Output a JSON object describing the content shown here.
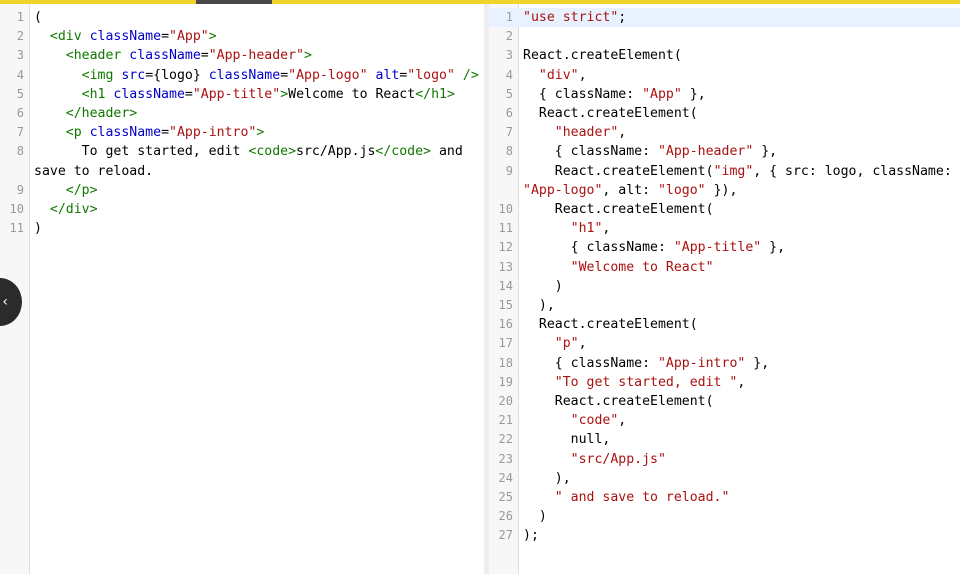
{
  "left_editor": {
    "lines": [
      {
        "num": "1",
        "tokens": [
          {
            "t": "(",
            "c": "def"
          }
        ]
      },
      {
        "num": "2",
        "tokens": [
          {
            "t": "  ",
            "c": "def"
          },
          {
            "t": "<div",
            "c": "tag"
          },
          {
            "t": " ",
            "c": "def"
          },
          {
            "t": "className",
            "c": "attr"
          },
          {
            "t": "=",
            "c": "def"
          },
          {
            "t": "\"App\"",
            "c": "str"
          },
          {
            "t": ">",
            "c": "tag"
          }
        ]
      },
      {
        "num": "3",
        "tokens": [
          {
            "t": "    ",
            "c": "def"
          },
          {
            "t": "<header",
            "c": "tag"
          },
          {
            "t": " ",
            "c": "def"
          },
          {
            "t": "className",
            "c": "attr"
          },
          {
            "t": "=",
            "c": "def"
          },
          {
            "t": "\"App-header\"",
            "c": "str"
          },
          {
            "t": ">",
            "c": "tag"
          }
        ]
      },
      {
        "num": "4",
        "tokens": [
          {
            "t": "      ",
            "c": "def"
          },
          {
            "t": "<img",
            "c": "tag"
          },
          {
            "t": " ",
            "c": "def"
          },
          {
            "t": "src",
            "c": "attr"
          },
          {
            "t": "={logo} ",
            "c": "def"
          },
          {
            "t": "className",
            "c": "attr"
          },
          {
            "t": "=",
            "c": "def"
          },
          {
            "t": "\"App-logo\"",
            "c": "str"
          },
          {
            "t": " ",
            "c": "def"
          },
          {
            "t": "alt",
            "c": "attr"
          },
          {
            "t": "=",
            "c": "def"
          },
          {
            "t": "\"logo\"",
            "c": "str"
          },
          {
            "t": " ",
            "c": "def"
          },
          {
            "t": "/>",
            "c": "tag"
          }
        ]
      },
      {
        "num": "5",
        "tokens": [
          {
            "t": "      ",
            "c": "def"
          },
          {
            "t": "<h1",
            "c": "tag"
          },
          {
            "t": " ",
            "c": "def"
          },
          {
            "t": "className",
            "c": "attr"
          },
          {
            "t": "=",
            "c": "def"
          },
          {
            "t": "\"App-title\"",
            "c": "str"
          },
          {
            "t": ">",
            "c": "tag"
          },
          {
            "t": "Welcome to React",
            "c": "def"
          },
          {
            "t": "</h1>",
            "c": "tag"
          }
        ]
      },
      {
        "num": "6",
        "tokens": [
          {
            "t": "    ",
            "c": "def"
          },
          {
            "t": "</header>",
            "c": "tag"
          }
        ]
      },
      {
        "num": "7",
        "tokens": [
          {
            "t": "    ",
            "c": "def"
          },
          {
            "t": "<p",
            "c": "tag"
          },
          {
            "t": " ",
            "c": "def"
          },
          {
            "t": "className",
            "c": "attr"
          },
          {
            "t": "=",
            "c": "def"
          },
          {
            "t": "\"App-intro\"",
            "c": "str"
          },
          {
            "t": ">",
            "c": "tag"
          }
        ]
      },
      {
        "num": "8",
        "tokens": [
          {
            "t": "      To get started, edit ",
            "c": "def"
          },
          {
            "t": "<code>",
            "c": "tag"
          },
          {
            "t": "src/App.js",
            "c": "def"
          },
          {
            "t": "</code>",
            "c": "tag"
          },
          {
            "t": " and save to reload.",
            "c": "def"
          }
        ]
      },
      {
        "num": "9",
        "tokens": [
          {
            "t": "    ",
            "c": "def"
          },
          {
            "t": "</p>",
            "c": "tag"
          }
        ]
      },
      {
        "num": "10",
        "tokens": [
          {
            "t": "  ",
            "c": "def"
          },
          {
            "t": "</div>",
            "c": "tag"
          }
        ]
      },
      {
        "num": "11",
        "tokens": [
          {
            "t": ")",
            "c": "def"
          }
        ]
      }
    ]
  },
  "right_editor": {
    "lines": [
      {
        "num": "1",
        "cur": true,
        "tokens": [
          {
            "t": "\"use strict\"",
            "c": "str"
          },
          {
            "t": ";",
            "c": "def"
          }
        ]
      },
      {
        "num": "2",
        "tokens": [
          {
            "t": "",
            "c": "def"
          }
        ]
      },
      {
        "num": "3",
        "tokens": [
          {
            "t": "React.createElement(",
            "c": "def"
          }
        ]
      },
      {
        "num": "4",
        "tokens": [
          {
            "t": "  ",
            "c": "def"
          },
          {
            "t": "\"div\"",
            "c": "str"
          },
          {
            "t": ",",
            "c": "def"
          }
        ]
      },
      {
        "num": "5",
        "tokens": [
          {
            "t": "  { className: ",
            "c": "def"
          },
          {
            "t": "\"App\"",
            "c": "str"
          },
          {
            "t": " },",
            "c": "def"
          }
        ]
      },
      {
        "num": "6",
        "tokens": [
          {
            "t": "  React.createElement(",
            "c": "def"
          }
        ]
      },
      {
        "num": "7",
        "tokens": [
          {
            "t": "    ",
            "c": "def"
          },
          {
            "t": "\"header\"",
            "c": "str"
          },
          {
            "t": ",",
            "c": "def"
          }
        ]
      },
      {
        "num": "8",
        "tokens": [
          {
            "t": "    { className: ",
            "c": "def"
          },
          {
            "t": "\"App-header\"",
            "c": "str"
          },
          {
            "t": " },",
            "c": "def"
          }
        ]
      },
      {
        "num": "9",
        "tokens": [
          {
            "t": "    React.createElement(",
            "c": "def"
          },
          {
            "t": "\"img\"",
            "c": "str"
          },
          {
            "t": ", { src: logo, className: ",
            "c": "def"
          },
          {
            "t": "\"App-logo\"",
            "c": "str"
          },
          {
            "t": ", alt: ",
            "c": "def"
          },
          {
            "t": "\"logo\"",
            "c": "str"
          },
          {
            "t": " }),",
            "c": "def"
          }
        ]
      },
      {
        "num": "10",
        "tokens": [
          {
            "t": "    React.createElement(",
            "c": "def"
          }
        ]
      },
      {
        "num": "11",
        "tokens": [
          {
            "t": "      ",
            "c": "def"
          },
          {
            "t": "\"h1\"",
            "c": "str"
          },
          {
            "t": ",",
            "c": "def"
          }
        ]
      },
      {
        "num": "12",
        "tokens": [
          {
            "t": "      { className: ",
            "c": "def"
          },
          {
            "t": "\"App-title\"",
            "c": "str"
          },
          {
            "t": " },",
            "c": "def"
          }
        ]
      },
      {
        "num": "13",
        "tokens": [
          {
            "t": "      ",
            "c": "def"
          },
          {
            "t": "\"Welcome to React\"",
            "c": "str"
          }
        ]
      },
      {
        "num": "14",
        "tokens": [
          {
            "t": "    )",
            "c": "def"
          }
        ]
      },
      {
        "num": "15",
        "tokens": [
          {
            "t": "  ),",
            "c": "def"
          }
        ]
      },
      {
        "num": "16",
        "tokens": [
          {
            "t": "  React.createElement(",
            "c": "def"
          }
        ]
      },
      {
        "num": "17",
        "tokens": [
          {
            "t": "    ",
            "c": "def"
          },
          {
            "t": "\"p\"",
            "c": "str"
          },
          {
            "t": ",",
            "c": "def"
          }
        ]
      },
      {
        "num": "18",
        "tokens": [
          {
            "t": "    { className: ",
            "c": "def"
          },
          {
            "t": "\"App-intro\"",
            "c": "str"
          },
          {
            "t": " },",
            "c": "def"
          }
        ]
      },
      {
        "num": "19",
        "tokens": [
          {
            "t": "    ",
            "c": "def"
          },
          {
            "t": "\"To get started, edit \"",
            "c": "str"
          },
          {
            "t": ",",
            "c": "def"
          }
        ]
      },
      {
        "num": "20",
        "tokens": [
          {
            "t": "    React.createElement(",
            "c": "def"
          }
        ]
      },
      {
        "num": "21",
        "tokens": [
          {
            "t": "      ",
            "c": "def"
          },
          {
            "t": "\"code\"",
            "c": "str"
          },
          {
            "t": ",",
            "c": "def"
          }
        ]
      },
      {
        "num": "22",
        "tokens": [
          {
            "t": "      null,",
            "c": "def"
          }
        ]
      },
      {
        "num": "23",
        "tokens": [
          {
            "t": "      ",
            "c": "def"
          },
          {
            "t": "\"src/App.js\"",
            "c": "str"
          }
        ]
      },
      {
        "num": "24",
        "tokens": [
          {
            "t": "    ),",
            "c": "def"
          }
        ]
      },
      {
        "num": "25",
        "tokens": [
          {
            "t": "    ",
            "c": "def"
          },
          {
            "t": "\" and save to reload.\"",
            "c": "str"
          }
        ]
      },
      {
        "num": "26",
        "tokens": [
          {
            "t": "  )",
            "c": "def"
          }
        ]
      },
      {
        "num": "27",
        "tokens": [
          {
            "t": ");",
            "c": "def"
          }
        ]
      }
    ]
  },
  "collapse_handle": {
    "icon": "chevron-left-icon",
    "glyph": "‹"
  }
}
